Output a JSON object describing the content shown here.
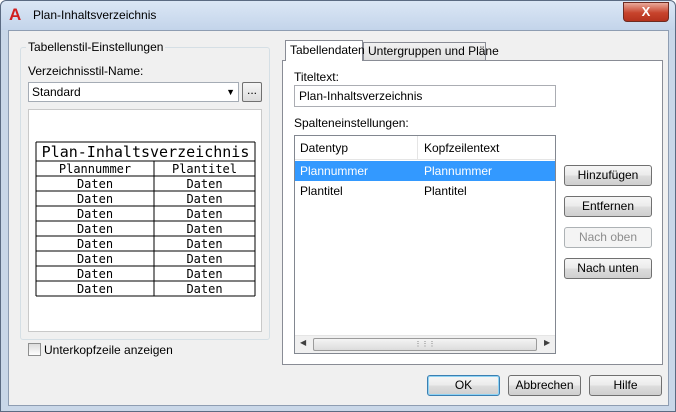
{
  "window": {
    "title": "Plan-Inhaltsverzeichnis",
    "close_glyph": "X",
    "app_icon": "autocad-a-icon"
  },
  "left_panel": {
    "group_title": "Tabellenstil-Einstellungen",
    "style_name_label": "Verzeichnisstil-Name:",
    "style_name_value": "Standard",
    "browse_button": "...",
    "preview": {
      "title": "Plan-Inhaltsverzeichnis",
      "headers": [
        "Plannummer",
        "Plantitel"
      ],
      "row_value": "Daten",
      "row_count": 8
    },
    "subheader_checkbox_label": "Unterkopfzeile anzeigen",
    "subheader_checked": false
  },
  "tabs": [
    {
      "label": "Tabellendaten",
      "active": true
    },
    {
      "label": "Untergruppen und Pläne",
      "active": false
    }
  ],
  "table_data": {
    "title_text_label": "Titeltext:",
    "title_text_value": "Plan-Inhaltsverzeichnis",
    "column_settings_label": "Spalteneinstellungen:",
    "columns": [
      "Datentyp",
      "Kopfzeilentext"
    ],
    "rows": [
      {
        "datatype": "Plannummer",
        "header": "Plannummer",
        "selected": true
      },
      {
        "datatype": "Plantitel",
        "header": "Plantitel",
        "selected": false
      }
    ],
    "buttons": {
      "add": "Hinzufügen",
      "remove": "Entfernen",
      "move_up": "Nach oben",
      "move_down": "Nach unten"
    }
  },
  "footer": {
    "ok": "OK",
    "cancel": "Abbrechen",
    "help": "Hilfe"
  },
  "colors": {
    "selection": "#3399ff",
    "app_icon_red": "#d11f1f"
  }
}
